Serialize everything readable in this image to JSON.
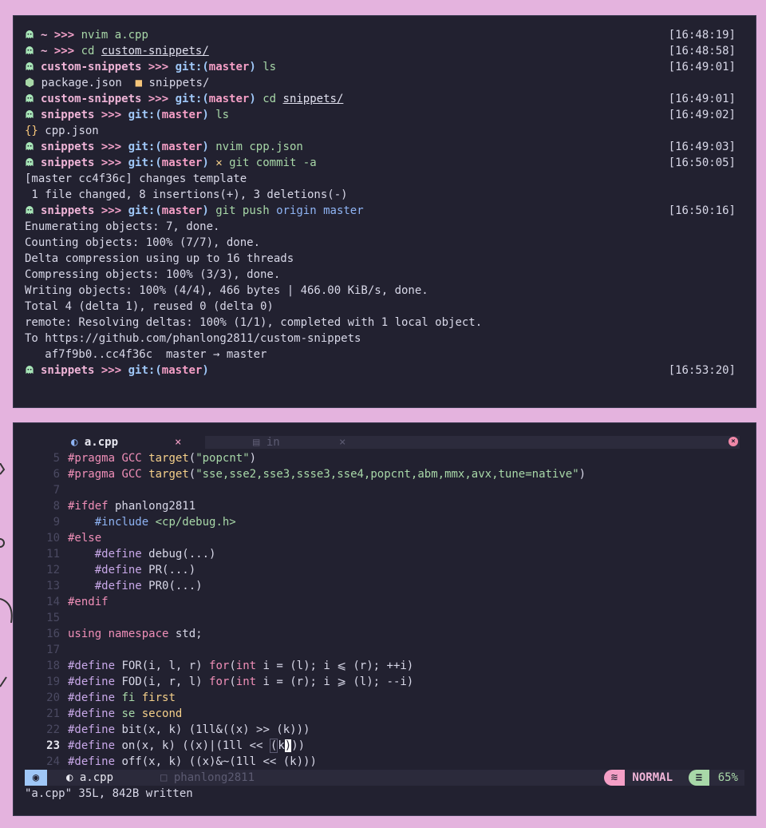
{
  "terminal": {
    "lines": [
      {
        "kind": "prompt",
        "dir": "~",
        "arrow": ">>>",
        "cmd": "nvim",
        "arg": "a.cpp",
        "time": "[16:48:19]"
      },
      {
        "kind": "prompt",
        "dir": "~",
        "arrow": ">>>",
        "cmd": "cd",
        "arg": "custom-snippets/",
        "time": "[16:48:58]"
      },
      {
        "kind": "prompt-git",
        "dir": "custom-snippets",
        "arrow": ">>>",
        "git": "git:(",
        "branch": "master",
        "close": ")",
        "cmd": "ls",
        "time": "[16:49:01]"
      },
      {
        "kind": "ls",
        "items": [
          "package.json",
          "snippets/"
        ]
      },
      {
        "kind": "prompt-git",
        "dir": "custom-snippets",
        "arrow": ">>>",
        "git": "git:(",
        "branch": "master",
        "close": ")",
        "cmd": "cd",
        "arg": "snippets/",
        "time": "[16:49:01]"
      },
      {
        "kind": "prompt-git",
        "dir": "snippets",
        "arrow": ">>>",
        "git": "git:(",
        "branch": "master",
        "close": ")",
        "cmd": "ls",
        "time": "[16:49:02]"
      },
      {
        "kind": "ls1",
        "item": "cpp.json"
      },
      {
        "kind": "prompt-git",
        "dir": "snippets",
        "arrow": ">>>",
        "git": "git:(",
        "branch": "master",
        "close": ")",
        "cmd": "nvim",
        "arg": "cpp.json",
        "time": "[16:49:03]"
      },
      {
        "kind": "prompt-git",
        "dir": "snippets",
        "arrow": ">>>",
        "git": "git:(",
        "branch": "master",
        "close": ")",
        "dirty": "✕",
        "cmd": "git commit -a",
        "time": "[16:50:05]"
      },
      {
        "kind": "out",
        "text": "[master cc4f36c] changes template"
      },
      {
        "kind": "out",
        "text": " 1 file changed, 8 insertions(+), 3 deletions(-)"
      },
      {
        "kind": "prompt-git",
        "dir": "snippets",
        "arrow": ">>>",
        "git": "git:(",
        "branch": "master",
        "close": ")",
        "cmd": "git push",
        "arg2": "origin master",
        "time": "[16:50:16]"
      },
      {
        "kind": "out",
        "text": "Enumerating objects: 7, done."
      },
      {
        "kind": "out",
        "text": "Counting objects: 100% (7/7), done."
      },
      {
        "kind": "out",
        "text": "Delta compression using up to 16 threads"
      },
      {
        "kind": "out",
        "text": "Compressing objects: 100% (3/3), done."
      },
      {
        "kind": "out",
        "text": "Writing objects: 100% (4/4), 466 bytes | 466.00 KiB/s, done."
      },
      {
        "kind": "out",
        "text": "Total 4 (delta 1), reused 0 (delta 0)"
      },
      {
        "kind": "out",
        "text": "remote: Resolving deltas: 100% (1/1), completed with 1 local object."
      },
      {
        "kind": "out",
        "text": "To https://github.com/phanlong2811/custom-snippets"
      },
      {
        "kind": "out",
        "text": "   af7f9b0..cc4f36c  master → master"
      },
      {
        "kind": "prompt-git",
        "dir": "snippets",
        "arrow": ">>>",
        "git": "git:(",
        "branch": "master",
        "close": ")",
        "time": "[16:53:20]"
      }
    ]
  },
  "vim": {
    "tabs": [
      {
        "label": "a.cpp",
        "icon": "cpp-icon",
        "close": "×",
        "active": true
      },
      {
        "label": "in",
        "icon": "file-icon",
        "close": "×",
        "active": false
      }
    ],
    "close_all": "×",
    "code": [
      {
        "n": "5",
        "html": "<span class='pp'>#pragma</span> <span class='kw'>GCC</span> <span class='yel'>target</span>(<span class='str'>\"popcnt\"</span>)"
      },
      {
        "n": "6",
        "html": "<span class='pp'>#pragma</span> <span class='kw'>GCC</span> <span class='yel'>target</span>(<span class='str'>\"sse,sse2,sse3,ssse3,sse4,popcnt,abm,mmx,avx,tune=native\"</span>)"
      },
      {
        "n": "7",
        "html": ""
      },
      {
        "n": "8",
        "html": "<span class='pp'>#ifdef</span> phanlong2811"
      },
      {
        "n": "9",
        "html": "    <span class='blu'>#include</span> <span class='inc'>&lt;cp/debug.h&gt;</span>"
      },
      {
        "n": "10",
        "html": "<span class='pp'>#else</span>"
      },
      {
        "n": "11",
        "html": "    <span class='pur'>#define</span> debug(...)"
      },
      {
        "n": "12",
        "html": "    <span class='pur'>#define</span> PR(...)"
      },
      {
        "n": "13",
        "html": "    <span class='pur'>#define</span> PR0(...)"
      },
      {
        "n": "14",
        "html": "<span class='pp'>#endif</span>"
      },
      {
        "n": "15",
        "html": ""
      },
      {
        "n": "16",
        "html": "<span class='kw'>using namespace</span> std;"
      },
      {
        "n": "17",
        "html": ""
      },
      {
        "n": "18",
        "html": "<span class='pur'>#define</span> FOR(i, l, r) <span class='kw'>for</span>(<span class='kw'>int</span> i = (l); i ⩽ (r); ++i)"
      },
      {
        "n": "19",
        "html": "<span class='pur'>#define</span> FOD(i, r, l) <span class='kw'>for</span>(<span class='kw'>int</span> i = (r); i ⩾ (l); --i)"
      },
      {
        "n": "20",
        "html": "<span class='pur'>#define</span> <span class='grn'>fi</span> <span class='yel'>first</span>"
      },
      {
        "n": "21",
        "html": "<span class='pur'>#define</span> <span class='grn'>se</span> <span class='yel'>second</span>"
      },
      {
        "n": "22",
        "html": "<span class='pur'>#define</span> bit(x, k) (1ll&amp;((x) &gt;&gt; (k)))"
      },
      {
        "n": "23",
        "cur": true,
        "html": "<span class='pur'>#define</span> on(x, k) ((x)|(1ll &lt;&lt; <span class='pbr'>(</span>k<span class='cursor'>)</span>))"
      },
      {
        "n": "24",
        "html": "<span class='pur'>#define</span> off(x, k) ((x)&amp;~(1ll &lt;&lt; (k)))"
      }
    ],
    "status": {
      "file": "a.cpp",
      "branch": "phanlong2811",
      "mode": "NORMAL",
      "percent": "65%"
    },
    "message": "\"a.cpp\" 35L, 842B written"
  },
  "colors": {
    "bg": "#e4b3de",
    "panel": "#222130",
    "pink": "#f59fc6",
    "green": "#a8d8a8",
    "blue": "#9fc7f7"
  }
}
